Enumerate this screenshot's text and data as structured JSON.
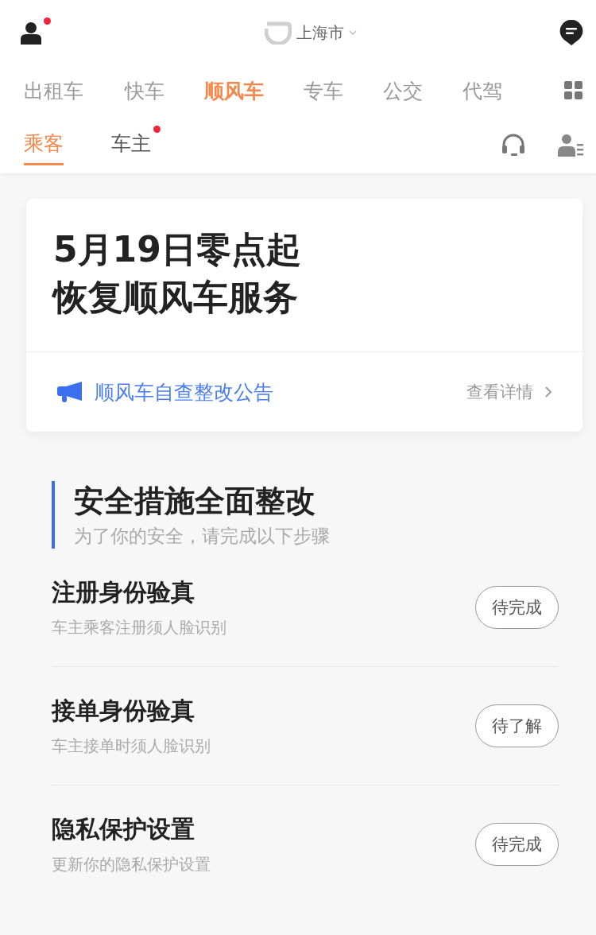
{
  "header": {
    "city": "上海市",
    "profile_badge": true
  },
  "service_tabs": [
    {
      "label": "出租车",
      "selected": false
    },
    {
      "label": "快车",
      "selected": false
    },
    {
      "label": "顺风车",
      "selected": true
    },
    {
      "label": "专车",
      "selected": false
    },
    {
      "label": "公交",
      "selected": false
    },
    {
      "label": "代驾",
      "selected": false
    }
  ],
  "role_tabs": [
    {
      "label": "乘客",
      "selected": true,
      "badge": false
    },
    {
      "label": "车主",
      "selected": false,
      "badge": true
    }
  ],
  "notice_card": {
    "headline": [
      "5月19日零点起",
      "恢复顺风车服务"
    ],
    "announcement": "顺风车自查整改公告",
    "details_link": "查看详情"
  },
  "section": {
    "title": "安全措施全面整改",
    "subtitle": "为了你的安全，请完成以下步骤"
  },
  "steps": [
    {
      "title": "注册身份验真",
      "description": "车主乘客注册须人脸识别",
      "status": "待完成"
    },
    {
      "title": "接单身份验真",
      "description": "车主接单时须人脸识别",
      "status": "待了解"
    },
    {
      "title": "隐私保护设置",
      "description": "更新你的隐私保护设置",
      "status": "待完成"
    }
  ]
}
